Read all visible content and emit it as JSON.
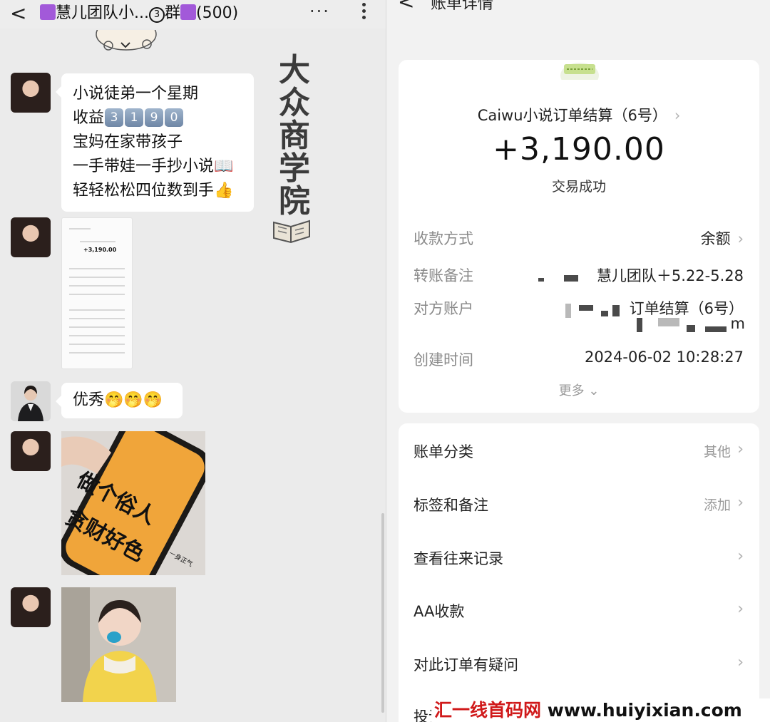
{
  "chat": {
    "back": "<",
    "title_prefix": "慧儿团队小...",
    "title_num": "3",
    "title_suffix": "群",
    "title_count": "(500)",
    "more_dots": "···",
    "messages": {
      "m1_lines": [
        "小说徒弟一个星期",
        "收益",
        "宝妈在家带孩子",
        "一手带娃一手抄小说📖",
        "轻轻松松四位数到手👍"
      ],
      "m1_digits": [
        "3",
        "1",
        "9",
        "0"
      ],
      "m3_text": "优秀🤭🤭🤭"
    },
    "watermark": [
      "大",
      "众",
      "商",
      "学",
      "院"
    ],
    "mini_shot_amount": "+3,190.00",
    "phone_text": [
      "做个俗人",
      "贪财好色"
    ],
    "phone_sig": "一身正气"
  },
  "bill": {
    "back": "<",
    "title": "账单详情",
    "merchant": "Caiwu小说订单结算（6号）",
    "amount": "+3,190.00",
    "status": "交易成功",
    "rows": {
      "method_label": "收款方式",
      "method_value": "余额",
      "memo_label": "转账备注",
      "memo_value": "慧儿团队＋5.22-5.28",
      "account_label": "对方账户",
      "account_value": "订单结算（6号）",
      "account_tail": "m",
      "time_label": "创建时间",
      "time_value": "2024-06-02 10:28:27"
    },
    "more": "更多",
    "list": [
      {
        "label": "账单分类",
        "value": "其他"
      },
      {
        "label": "标签和备注",
        "value": "添加"
      },
      {
        "label": "查看往来记录",
        "value": ""
      },
      {
        "label": "AA收款",
        "value": ""
      },
      {
        "label": "对此订单有疑问",
        "value": ""
      },
      {
        "label": "投诉",
        "value": ""
      }
    ]
  },
  "site_watermark": {
    "cn": "汇一线首码网",
    "url": "www.huiyixian.com"
  }
}
